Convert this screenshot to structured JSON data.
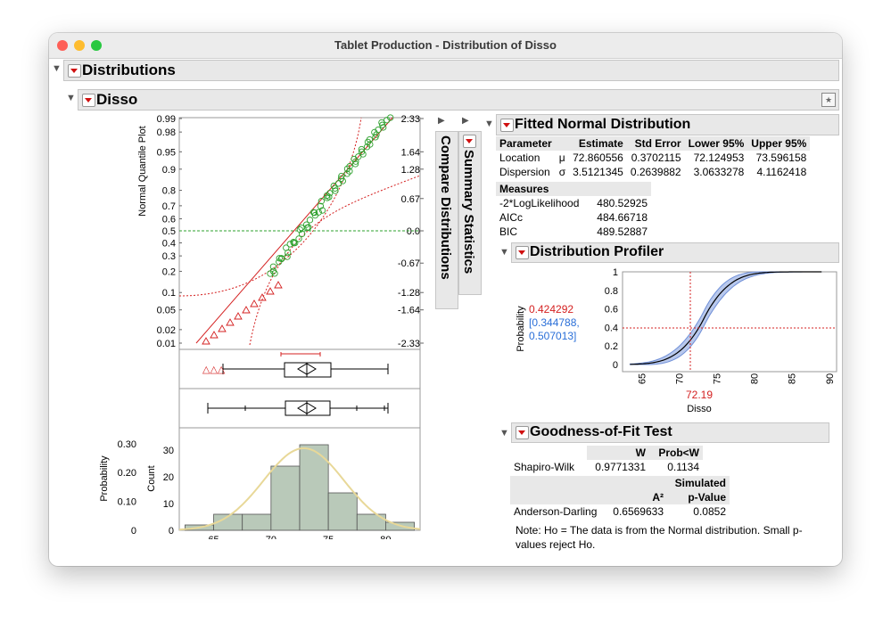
{
  "window": {
    "title": "Tablet Production - Distribution of Disso"
  },
  "distributions": {
    "title": "Distributions"
  },
  "disso": {
    "title": "Disso"
  },
  "side_outlines": {
    "compare": "Compare Distributions",
    "summary": "Summary Statistics"
  },
  "quantile_plot": {
    "ylabel": "Normal Quantile Plot",
    "prob_ticks": [
      "0.99",
      "0.98",
      "0.95",
      "0.9",
      "0.8",
      "0.7",
      "0.6",
      "0.5",
      "0.4",
      "0.3",
      "0.2",
      "0.1",
      "0.05",
      "0.02",
      "0.01"
    ],
    "z_ticks": [
      "2.33",
      "1.64",
      "1.28",
      "0.67",
      "0.0",
      "-0.67",
      "-1.28",
      "-1.64",
      "-2.33"
    ]
  },
  "histogram": {
    "ylabel_prob": "Probability",
    "ylabel_count": "Count",
    "prob_ticks": [
      "0.30",
      "0.20",
      "0.10",
      "0"
    ],
    "count_ticks": [
      "30",
      "20",
      "10",
      "0"
    ],
    "x_ticks": [
      "65",
      "70",
      "75",
      "80"
    ],
    "bins": [
      {
        "from": 62.5,
        "to": 65,
        "count": 2
      },
      {
        "from": 65,
        "to": 67.5,
        "count": 6
      },
      {
        "from": 67.5,
        "to": 70,
        "count": 6
      },
      {
        "from": 70,
        "to": 72.5,
        "count": 24
      },
      {
        "from": 72.5,
        "to": 75,
        "count": 32
      },
      {
        "from": 75,
        "to": 77.5,
        "count": 14
      },
      {
        "from": 77.5,
        "to": 80,
        "count": 6
      },
      {
        "from": 80,
        "to": 82.5,
        "count": 3
      }
    ]
  },
  "fitted_normal": {
    "title": "Fitted Normal Distribution",
    "headers": [
      "Parameter",
      "",
      "Estimate",
      "Std Error",
      "Lower 95%",
      "Upper 95%"
    ],
    "rows": [
      {
        "name": "Location",
        "sym": "μ",
        "estimate": "72.860556",
        "stderr": "0.3702115",
        "lower": "72.124953",
        "upper": "73.596158"
      },
      {
        "name": "Dispersion",
        "sym": "σ",
        "estimate": "3.5121345",
        "stderr": "0.2639882",
        "lower": "3.0633278",
        "upper": "4.1162418"
      }
    ],
    "measures_label": "Measures",
    "measures": [
      {
        "name": "-2*LogLikelihood",
        "value": "480.52925"
      },
      {
        "name": "AICc",
        "value": "484.66718"
      },
      {
        "name": "BIC",
        "value": "489.52887"
      }
    ]
  },
  "profiler": {
    "title": "Distribution Profiler",
    "ylabel": "Probability",
    "xlabel": "Disso",
    "prob_value": "0.424292",
    "ci_line1": "[0.344788,",
    "ci_line2": "0.507013]",
    "x_value": "72.19",
    "y_ticks": [
      "1",
      "0.8",
      "0.6",
      "0.4",
      "0.2",
      "0"
    ],
    "x_ticks": [
      "65",
      "70",
      "75",
      "80",
      "85",
      "90"
    ]
  },
  "gof": {
    "title": "Goodness-of-Fit Test",
    "sw_headers": [
      "W",
      "Prob<W"
    ],
    "sw_row": {
      "name": "Shapiro-Wilk",
      "w": "0.9771331",
      "p": "0.1134"
    },
    "ad_header_a2": "A²",
    "ad_header_sim1": "Simulated",
    "ad_header_sim2": "p-Value",
    "ad_row": {
      "name": "Anderson-Darling",
      "a2": "0.6569633",
      "p": "0.0852"
    },
    "note_line1": "Note: Ho = The data is from the Normal distribution. Small p-",
    "note_line2": "values reject Ho."
  },
  "colors": {
    "red": "#d42020",
    "green": "#2ca02c",
    "blue": "#2a6fd8",
    "hist_fill": "#b9c9b9",
    "curve": "#e8d898"
  }
}
